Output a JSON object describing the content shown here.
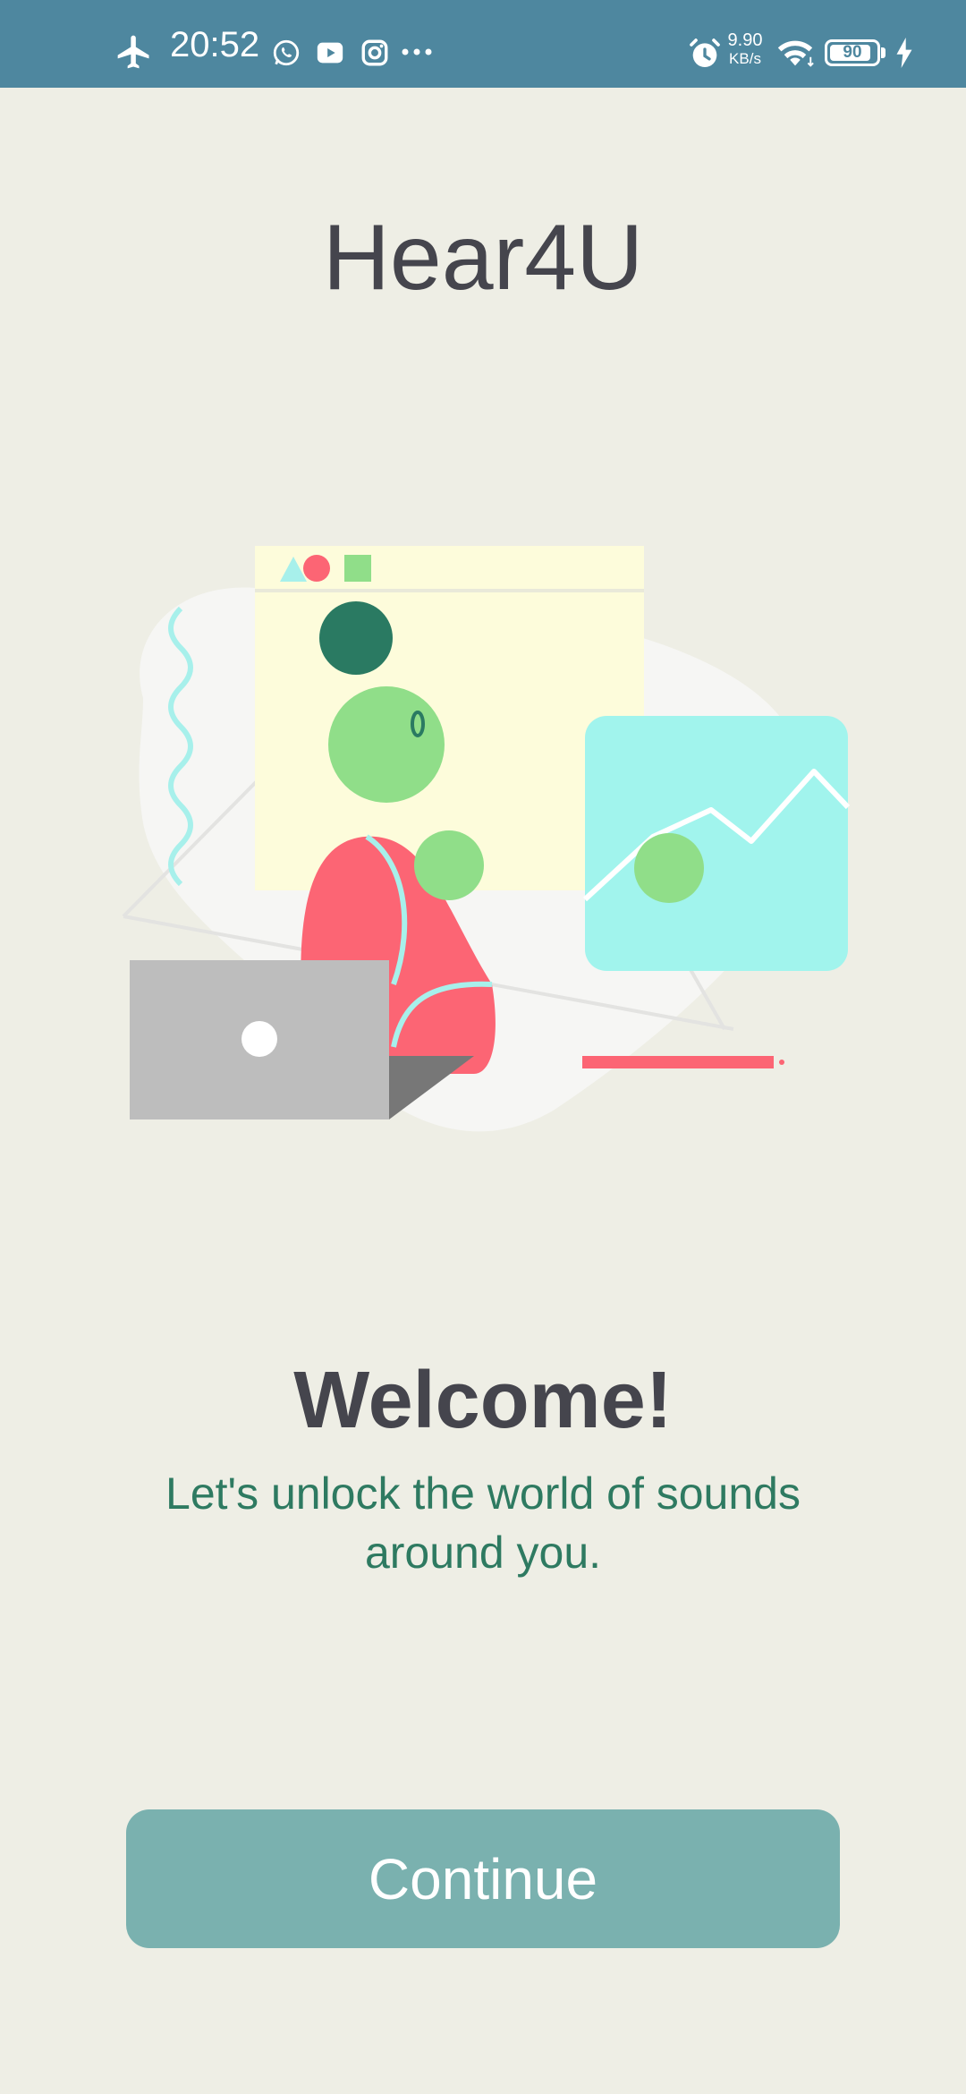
{
  "status_bar": {
    "time": "20:52",
    "network_speed_value": "9.90",
    "network_speed_unit": "KB/s",
    "battery_level": "90",
    "battery_percent": 0.9,
    "icons": [
      "airplane-mode-icon",
      "whatsapp-icon",
      "youtube-icon",
      "instagram-icon",
      "more-notifications-icon",
      "alarm-icon",
      "wifi-icon",
      "battery-icon",
      "charging-icon"
    ]
  },
  "header": {
    "app_title": "Hear4U"
  },
  "welcome": {
    "heading": "Welcome!",
    "subtitle": "Let's unlock the world of sounds around you."
  },
  "actions": {
    "continue_label": "Continue"
  },
  "colors": {
    "status_bar_bg": "#4E879F",
    "page_bg": "#EEEEE5",
    "title_text": "#45454D",
    "subtitle_text": "#2E7A61",
    "button_bg": "#7AB1AF",
    "button_text": "#FFFFFF"
  }
}
